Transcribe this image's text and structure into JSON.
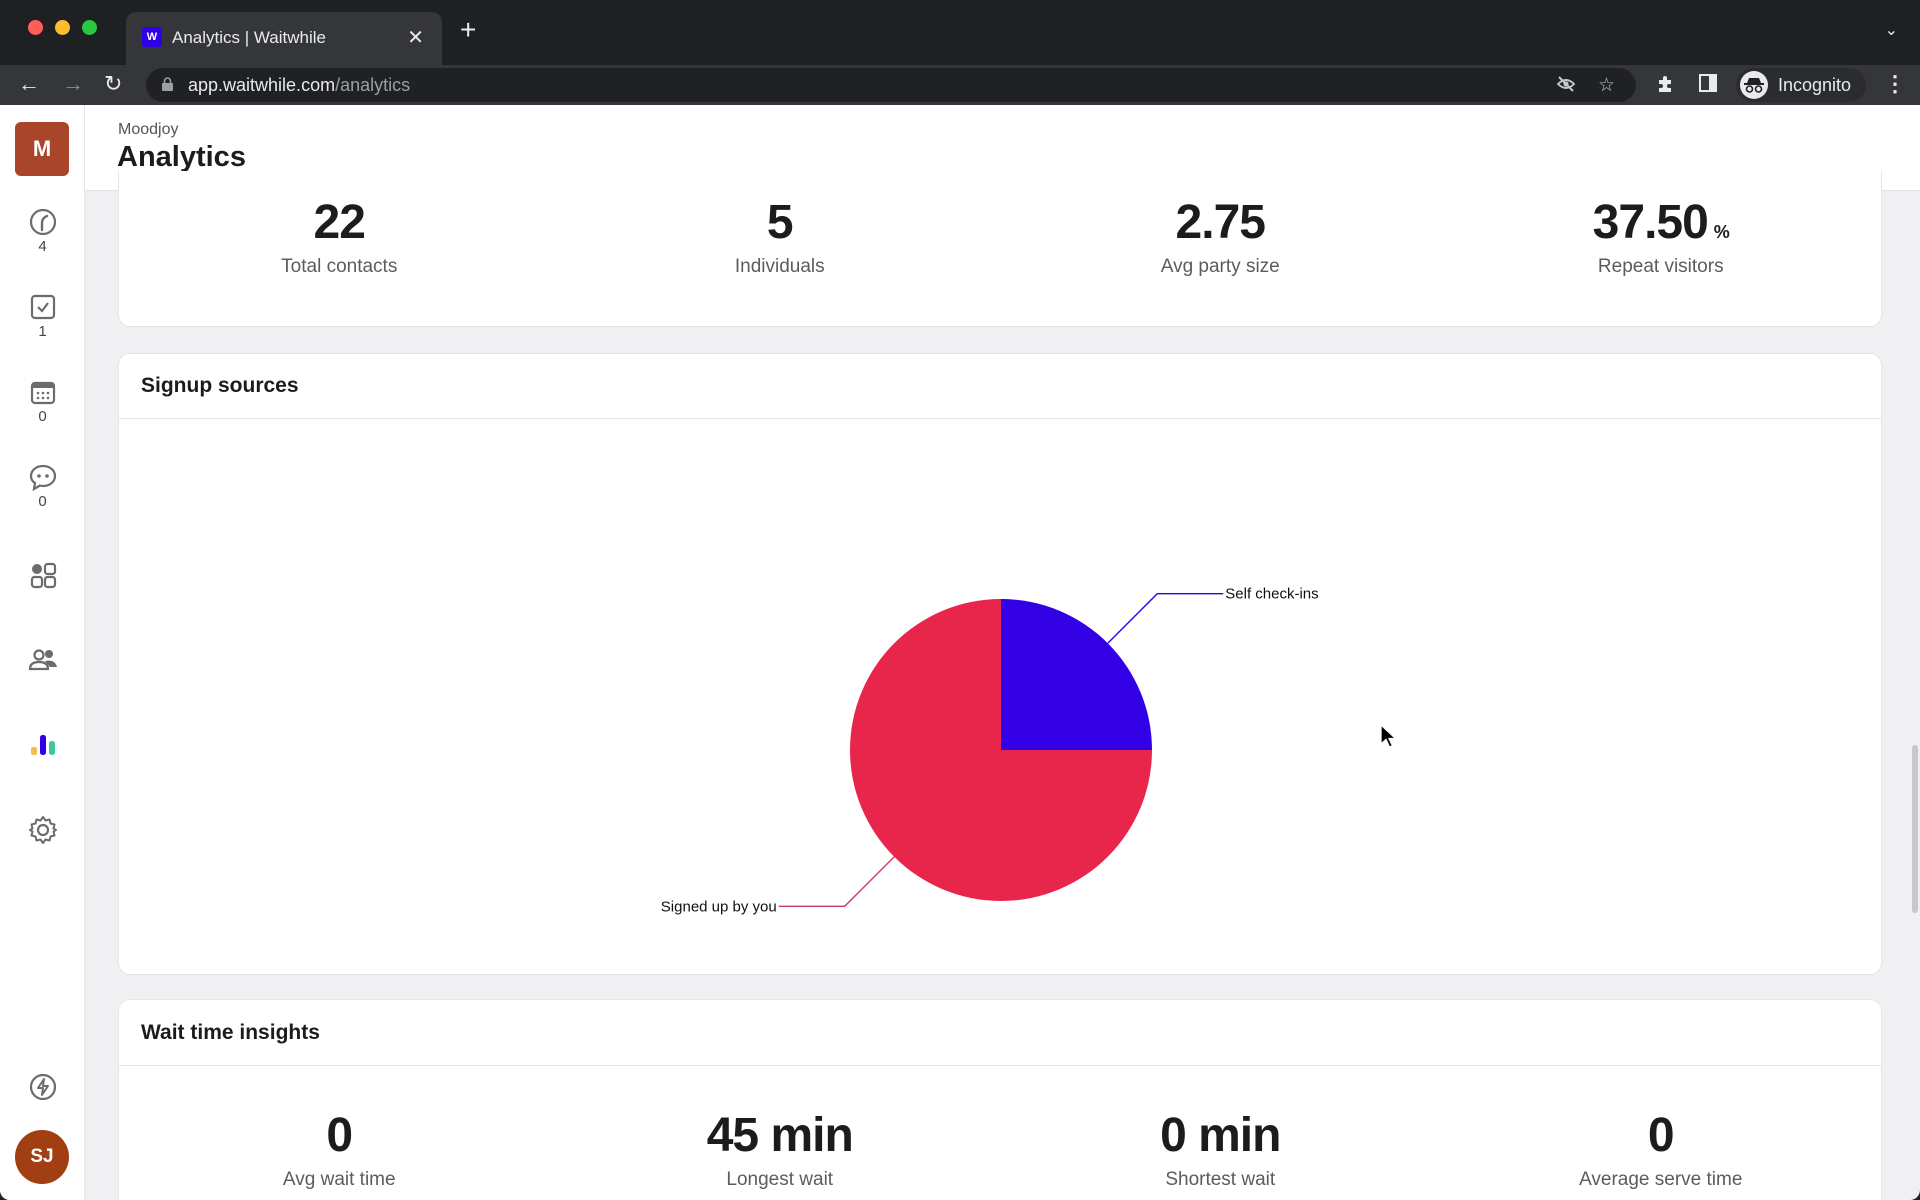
{
  "browser": {
    "tab_title": "Analytics | Waitwhile",
    "favicon_label": "W",
    "url_host": "app.waitwhile.com",
    "url_path": "/analytics",
    "profile_label": "Incognito"
  },
  "sidebar": {
    "org_initial": "M",
    "items": [
      {
        "name": "waitlist",
        "icon": "clock-icon",
        "count": "4"
      },
      {
        "name": "serve",
        "icon": "checkbox-icon",
        "count": "1"
      },
      {
        "name": "bookings",
        "icon": "calendar-icon",
        "count": "0"
      },
      {
        "name": "messages",
        "icon": "chat-icon",
        "count": "0"
      },
      {
        "name": "dashboard",
        "icon": "grid-icon"
      },
      {
        "name": "customers",
        "icon": "users-icon"
      },
      {
        "name": "analytics",
        "icon": "bar-chart-icon",
        "active": true
      },
      {
        "name": "settings",
        "icon": "gear-icon"
      },
      {
        "name": "upgrade",
        "icon": "lightning-icon"
      }
    ],
    "user_initials": "SJ"
  },
  "header": {
    "org_name": "Moodjoy",
    "page_title": "Analytics"
  },
  "visitor_stats": [
    {
      "value": "22",
      "label": "Total contacts"
    },
    {
      "value": "5",
      "label": "Individuals"
    },
    {
      "value": "2.75",
      "label": "Avg party size"
    },
    {
      "value": "37.50",
      "unit": "%",
      "label": "Repeat visitors"
    }
  ],
  "signup_sources": {
    "title": "Signup sources"
  },
  "chart_data": {
    "type": "pie",
    "title": "Signup sources",
    "slices": [
      {
        "label": "Self check-ins",
        "value": 25,
        "color": "#3300e6"
      },
      {
        "label": "Signed up by you",
        "value": 75,
        "color": "#e8264c"
      }
    ],
    "legend": "none",
    "labels": "outside-with-leader-lines"
  },
  "wait_time": {
    "title": "Wait time insights",
    "stats": [
      {
        "value": "0",
        "label": "Avg wait time"
      },
      {
        "value": "45 min",
        "label": "Longest wait"
      },
      {
        "value": "0 min",
        "label": "Shortest wait"
      },
      {
        "value": "0",
        "label": "Average serve time"
      }
    ]
  },
  "colors": {
    "accent": "#3300e6",
    "org_badge": "#a8452a",
    "user_avatar": "#a13e12"
  }
}
